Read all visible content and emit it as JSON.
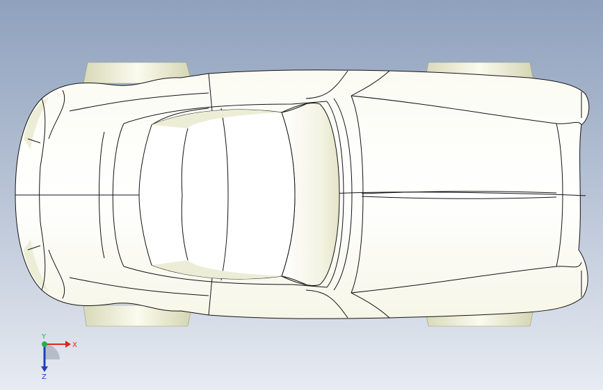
{
  "viewport": {
    "background_top": "#8fa1bd",
    "background_bottom": "#e7ebf2",
    "model_fill": "#ffffff",
    "model_shadow": "#eceed9",
    "edge_color": "#111111"
  },
  "triad": {
    "x_label": "X",
    "y_label": "Y",
    "z_label": "Z",
    "x_color": "#e2231a",
    "y_color": "#22b14c",
    "z_color": "#1f3fbf"
  }
}
